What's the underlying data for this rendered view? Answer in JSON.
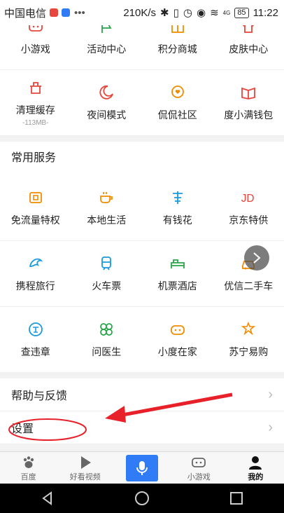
{
  "status": {
    "carrier": "中国电信",
    "speed": "210K/s",
    "network": "4G",
    "battery": "85",
    "time": "11:22"
  },
  "top_grid": [
    {
      "label": "小游戏",
      "icon": "gamepad-icon",
      "color": "#e8453c"
    },
    {
      "label": "活动中心",
      "icon": "flag-icon",
      "color": "#2aa54a"
    },
    {
      "label": "积分商城",
      "icon": "gift-icon",
      "color": "#f08c00"
    },
    {
      "label": "皮肤中心",
      "icon": "shirt-icon",
      "color": "#e8453c",
      "badge": true
    },
    {
      "label": "清理缓存",
      "sub": "-113MB-",
      "icon": "trash-icon",
      "color": "#e8453c"
    },
    {
      "label": "夜间模式",
      "icon": "moon-icon",
      "color": "#e8453c"
    },
    {
      "label": "侃侃社区",
      "icon": "chat-heart-icon",
      "color": "#f08c00"
    },
    {
      "label": "度小满钱包",
      "icon": "wallet-icon",
      "color": "#e8453c"
    }
  ],
  "services": {
    "title": "常用服务",
    "items": [
      {
        "label": "免流量特权",
        "icon": "sim-card-icon",
        "color": "#f08c00"
      },
      {
        "label": "本地生活",
        "icon": "coffee-cup-icon",
        "color": "#f08c00"
      },
      {
        "label": "有钱花",
        "icon": "money-icon",
        "color": "#1a9bdc"
      },
      {
        "label": "京东特供",
        "icon": "jd-logo-icon",
        "color": "#e8453c"
      },
      {
        "label": "携程旅行",
        "icon": "dolphin-icon",
        "color": "#1a9bdc"
      },
      {
        "label": "火车票",
        "icon": "train-icon",
        "color": "#1a9bdc"
      },
      {
        "label": "机票酒店",
        "icon": "bed-icon",
        "color": "#2aa54a"
      },
      {
        "label": "优信二手车",
        "icon": "car-icon",
        "color": "#f08c00"
      },
      {
        "label": "查违章",
        "icon": "violation-icon",
        "color": "#1a9bdc"
      },
      {
        "label": "问医生",
        "icon": "clover-icon",
        "color": "#2aa54a"
      },
      {
        "label": "小度在家",
        "icon": "robot-icon",
        "color": "#f08c00"
      },
      {
        "label": "苏宁易购",
        "icon": "suning-icon",
        "color": "#f08c00"
      }
    ]
  },
  "help_label": "帮助与反馈",
  "settings_label": "设置",
  "annotation_color": "#e8202a",
  "tabs": [
    {
      "label": "百度",
      "icon": "paw-icon"
    },
    {
      "label": "好看视频",
      "icon": "play-icon"
    },
    {
      "label": "",
      "icon": "mic-icon"
    },
    {
      "label": "小游戏",
      "icon": "gamepad-icon"
    },
    {
      "label": "我的",
      "icon": "user-icon"
    }
  ]
}
